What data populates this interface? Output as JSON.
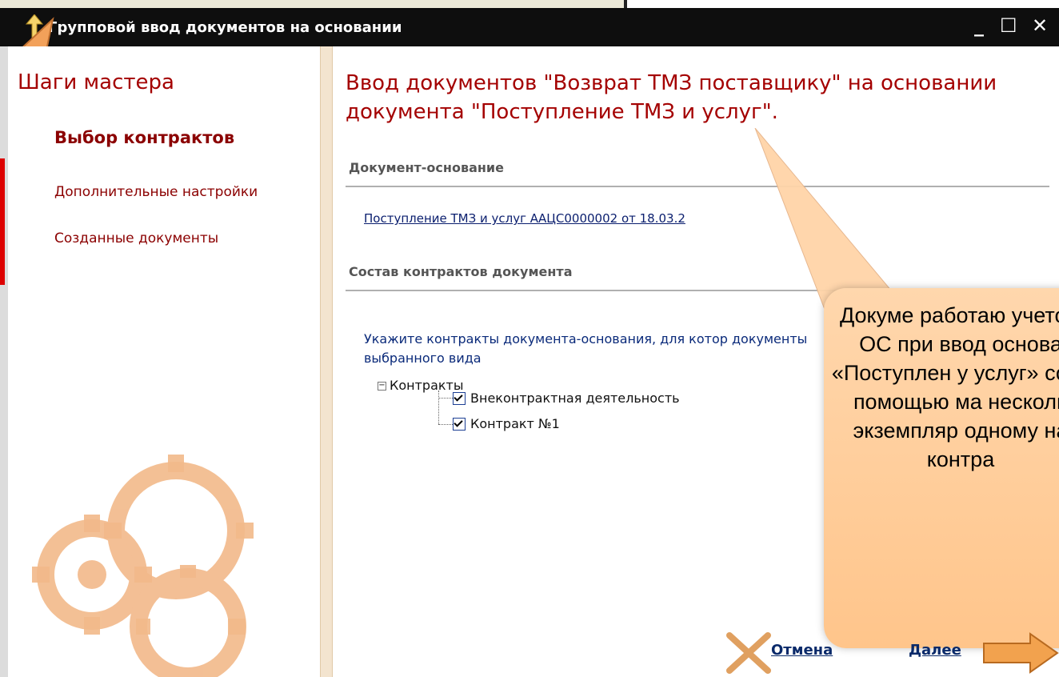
{
  "titlebar": {
    "title": "Групповой ввод документов на основании",
    "buttons": [
      "_",
      "☐",
      "✕"
    ]
  },
  "sidebar": {
    "title": "Шаги мастера",
    "steps": [
      {
        "label": "Выбор контрактов"
      },
      {
        "label": "Дополнительные настройки"
      },
      {
        "label": "Созданные документы"
      }
    ]
  },
  "main": {
    "heading": "Ввод документов \"Возврат ТМЗ поставщику\" на основании документа \"Поступление ТМЗ и услуг\".",
    "section_base": "Документ-основание",
    "base_link": "Поступление ТМЗ и услуг ААЦС0000002 от 18.03.2",
    "section_contracts": "Состав контрактов документа",
    "instructions": "Укажите контракты документа-основания, для котор документы выбранного вида",
    "tree": {
      "root": "Контракты",
      "items": [
        "Внеконтрактная деятельность",
        "Контракт №1"
      ]
    }
  },
  "callout": {
    "text": "Докуме работаю учетом ОС при ввод основа «Поступлен у услуг» созд помощью ма несколь экземпляр одному на контра"
  },
  "footer": {
    "cancel_label": "Отмена",
    "next_label": "Далее"
  },
  "colors": {
    "accent_red": "#a40000",
    "link_blue": "#0a1e6e",
    "callout_orange": "#ffc58b"
  }
}
